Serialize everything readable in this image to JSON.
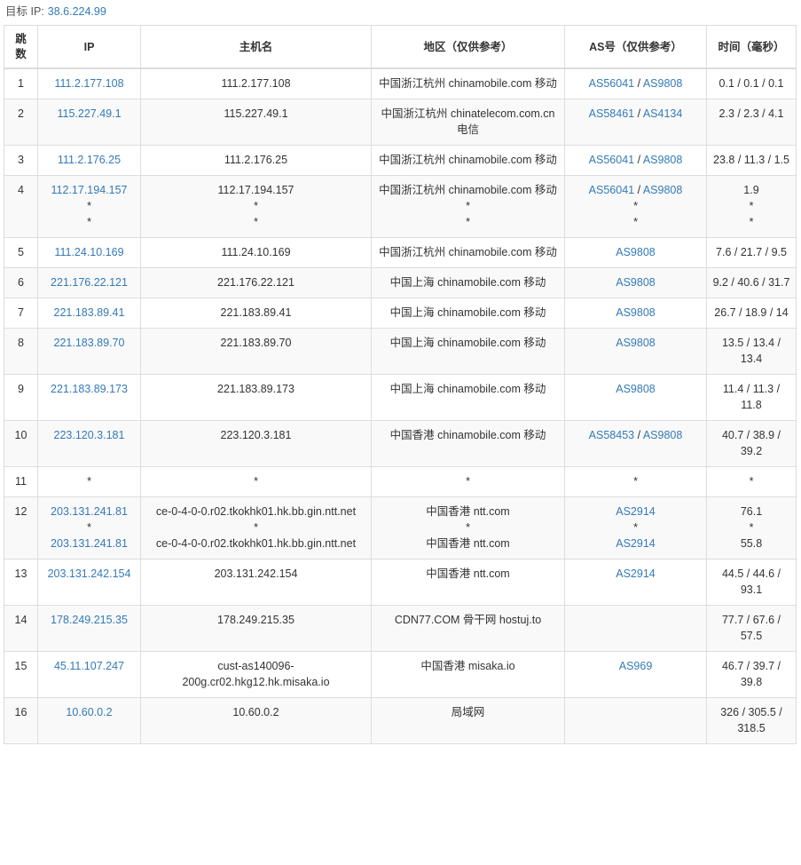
{
  "target": {
    "label": "目标 IP:",
    "ip": "38.6.224.99"
  },
  "headers": {
    "hop": "跳\n数",
    "ip": "IP",
    "host": "主机名",
    "region": "地区（仅供参考）",
    "as": "AS号（仅供参考）",
    "time": "时间（毫秒）"
  },
  "rows": [
    {
      "hop": "1",
      "ip": [
        "111.2.177.108"
      ],
      "host": [
        "111.2.177.108"
      ],
      "region": [
        "中国浙江杭州 chinamobile.com 移动"
      ],
      "as": [
        [
          "AS56041",
          "AS9808"
        ]
      ],
      "time": [
        "0.1 / 0.1 / 0.1"
      ]
    },
    {
      "hop": "2",
      "ip": [
        "115.227.49.1"
      ],
      "host": [
        "115.227.49.1"
      ],
      "region": [
        "中国浙江杭州 chinatelecom.com.cn 电信"
      ],
      "as": [
        [
          "AS58461",
          "AS4134"
        ]
      ],
      "time": [
        "2.3 / 2.3 / 4.1"
      ]
    },
    {
      "hop": "3",
      "ip": [
        "111.2.176.25"
      ],
      "host": [
        "111.2.176.25"
      ],
      "region": [
        "中国浙江杭州 chinamobile.com 移动"
      ],
      "as": [
        [
          "AS56041",
          "AS9808"
        ]
      ],
      "time": [
        "23.8 / 11.3 / 1.5"
      ]
    },
    {
      "hop": "4",
      "ip": [
        "112.17.194.157",
        "*",
        "*"
      ],
      "host": [
        "112.17.194.157",
        "*",
        "*"
      ],
      "region": [
        "中国浙江杭州 chinamobile.com 移动",
        "*",
        "*"
      ],
      "as": [
        [
          "AS56041",
          "AS9808"
        ],
        [
          "*"
        ],
        [
          "*"
        ]
      ],
      "time": [
        "1.9",
        "*",
        "*"
      ]
    },
    {
      "hop": "5",
      "ip": [
        "111.24.10.169"
      ],
      "host": [
        "111.24.10.169"
      ],
      "region": [
        "中国浙江杭州 chinamobile.com 移动"
      ],
      "as": [
        [
          "AS9808"
        ]
      ],
      "time": [
        "7.6 / 21.7 / 9.5"
      ]
    },
    {
      "hop": "6",
      "ip": [
        "221.176.22.121"
      ],
      "host": [
        "221.176.22.121"
      ],
      "region": [
        "中国上海 chinamobile.com 移动"
      ],
      "as": [
        [
          "AS9808"
        ]
      ],
      "time": [
        "9.2 / 40.6 / 31.7"
      ]
    },
    {
      "hop": "7",
      "ip": [
        "221.183.89.41"
      ],
      "host": [
        "221.183.89.41"
      ],
      "region": [
        "中国上海 chinamobile.com 移动"
      ],
      "as": [
        [
          "AS9808"
        ]
      ],
      "time": [
        "26.7 / 18.9 / 14"
      ]
    },
    {
      "hop": "8",
      "ip": [
        "221.183.89.70"
      ],
      "host": [
        "221.183.89.70"
      ],
      "region": [
        "中国上海 chinamobile.com 移动"
      ],
      "as": [
        [
          "AS9808"
        ]
      ],
      "time": [
        "13.5 / 13.4 / 13.4"
      ]
    },
    {
      "hop": "9",
      "ip": [
        "221.183.89.173"
      ],
      "host": [
        "221.183.89.173"
      ],
      "region": [
        "中国上海 chinamobile.com 移动"
      ],
      "as": [
        [
          "AS9808"
        ]
      ],
      "time": [
        "11.4 / 11.3 / 11.8"
      ]
    },
    {
      "hop": "10",
      "ip": [
        "223.120.3.181"
      ],
      "host": [
        "223.120.3.181"
      ],
      "region": [
        "中国香港 chinamobile.com 移动"
      ],
      "as": [
        [
          "AS58453",
          "AS9808"
        ]
      ],
      "time": [
        "40.7 / 38.9 / 39.2"
      ]
    },
    {
      "hop": "11",
      "ip": [
        "*"
      ],
      "host": [
        "*"
      ],
      "region": [
        "*"
      ],
      "as": [
        [
          "*"
        ]
      ],
      "time": [
        "*"
      ]
    },
    {
      "hop": "12",
      "ip": [
        "203.131.241.81",
        "*",
        "203.131.241.81"
      ],
      "host": [
        "ce-0-4-0-0.r02.tkokhk01.hk.bb.gin.ntt.net",
        "*",
        "ce-0-4-0-0.r02.tkokhk01.hk.bb.gin.ntt.net"
      ],
      "region": [
        "中国香港 ntt.com",
        "*",
        "中国香港 ntt.com"
      ],
      "as": [
        [
          "AS2914"
        ],
        [
          "*"
        ],
        [
          "AS2914"
        ]
      ],
      "time": [
        "76.1",
        "*",
        "55.8"
      ]
    },
    {
      "hop": "13",
      "ip": [
        "203.131.242.154"
      ],
      "host": [
        "203.131.242.154"
      ],
      "region": [
        "中国香港 ntt.com"
      ],
      "as": [
        [
          "AS2914"
        ]
      ],
      "time": [
        "44.5 / 44.6 / 93.1"
      ]
    },
    {
      "hop": "14",
      "ip": [
        "178.249.215.35"
      ],
      "host": [
        "178.249.215.35"
      ],
      "region": [
        "CDN77.COM 骨干网 hostuj.to"
      ],
      "as": [],
      "time": [
        "77.7 / 67.6 / 57.5"
      ]
    },
    {
      "hop": "15",
      "ip": [
        "45.11.107.247"
      ],
      "host": [
        "cust-as140096-200g.cr02.hkg12.hk.misaka.io"
      ],
      "region": [
        "中国香港 misaka.io"
      ],
      "as": [
        [
          "AS969"
        ]
      ],
      "time": [
        "46.7 / 39.7 / 39.8"
      ]
    },
    {
      "hop": "16",
      "ip": [
        "10.60.0.2"
      ],
      "host": [
        "10.60.0.2"
      ],
      "region": [
        "局域网"
      ],
      "as": [],
      "time": [
        "326 / 305.5 / 318.5"
      ]
    }
  ]
}
